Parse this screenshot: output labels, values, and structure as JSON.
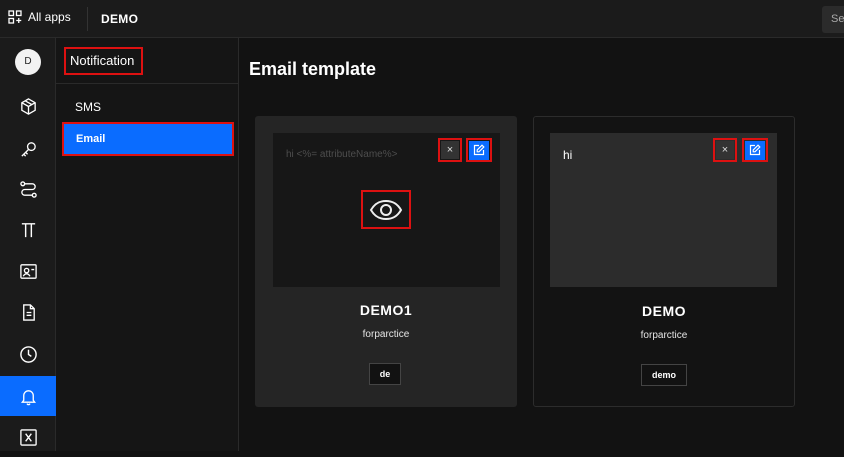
{
  "topbar": {
    "all_apps_label": "All apps",
    "app_name": "DEMO",
    "search_label": "Se"
  },
  "user": {
    "avatar_initial": "D"
  },
  "rail": {
    "items": [
      "cube-icon",
      "key-icon",
      "workflow-icon",
      "pi-icon",
      "id-card-icon",
      "document-icon",
      "clock-icon",
      "bell-icon",
      "variable-icon"
    ],
    "active": "bell-icon",
    "accent_color": "#0a6cff"
  },
  "sidenav": {
    "title": "Notification",
    "items": [
      {
        "label": "SMS",
        "active": false
      },
      {
        "label": "Email",
        "active": true
      }
    ]
  },
  "main": {
    "title": "Email template",
    "templates": [
      {
        "name": "DEMO1",
        "subtitle": "forparctice",
        "tag": "de",
        "preview_text": "hi <%= attributeName%>"
      },
      {
        "name": "DEMO",
        "subtitle": "forparctice",
        "tag": "demo",
        "preview_text": "hi"
      }
    ],
    "delete_symbol": "×"
  }
}
